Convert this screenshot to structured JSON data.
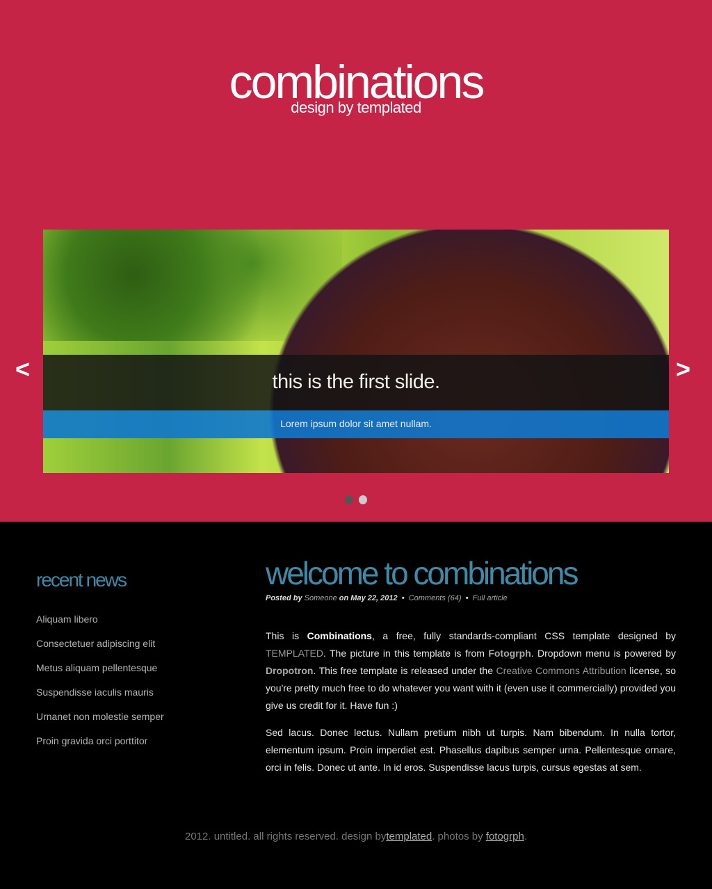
{
  "site": {
    "title": "combinations",
    "tagline": "design by templated"
  },
  "slider": {
    "caption": "this is the first slide.",
    "subcaption": "Lorem ipsum dolor sit amet nullam.",
    "prev": "<",
    "next": ">",
    "slide_count": 2,
    "active_slide": 1
  },
  "sidebar": {
    "heading": "recent news",
    "items": [
      "Aliquam libero",
      "Consectetuer adipiscing elit",
      "Metus aliquam pellentesque",
      "Suspendisse iaculis mauris",
      "Urnanet non molestie semper",
      "Proin gravida orci porttitor"
    ]
  },
  "post": {
    "title": "welcome to combinations",
    "meta": {
      "posted_by": "Posted by",
      "author": "Someone",
      "on": "on May 22, 2012",
      "sep": "•",
      "comments": "Comments (64)",
      "full": "Full article"
    },
    "p1": {
      "a": "This  is ",
      "b": "Combinations",
      "c": ", a free, fully standards-compliant CSS template designed by ",
      "d": "TEMPLATED",
      "e": ". The picture in this template is from ",
      "f": "Fotogrph",
      "g": ". Dropdown menu is powered by ",
      "h": "Dropotron",
      "i": ". This free template is released under the ",
      "j": "Creative Commons Attribution",
      "k": " license, so you're pretty much free to do whatever you want with it (even use it commercially) provided you give us credit for it. Have fun :)"
    },
    "p2": "Sed lacus. Donec lectus. Nullam pretium nibh ut turpis. Nam bibendum. In nulla tortor, elementum ipsum. Proin imperdiet est. Phasellus dapibus semper urna. Pellentesque ornare, orci in felis. Donec ut ante. In id eros. Suspendisse lacus turpis, cursus egestas at sem."
  },
  "footer": {
    "text": "2012. untitled. all rights reserved. design by",
    "link1": "templated",
    "mid": ". photos by ",
    "link2": "fotogrph",
    "end": "."
  },
  "colors": {
    "header": "#c52447",
    "accent": "#3e8aa8",
    "caption_blue": "#1078cd"
  }
}
